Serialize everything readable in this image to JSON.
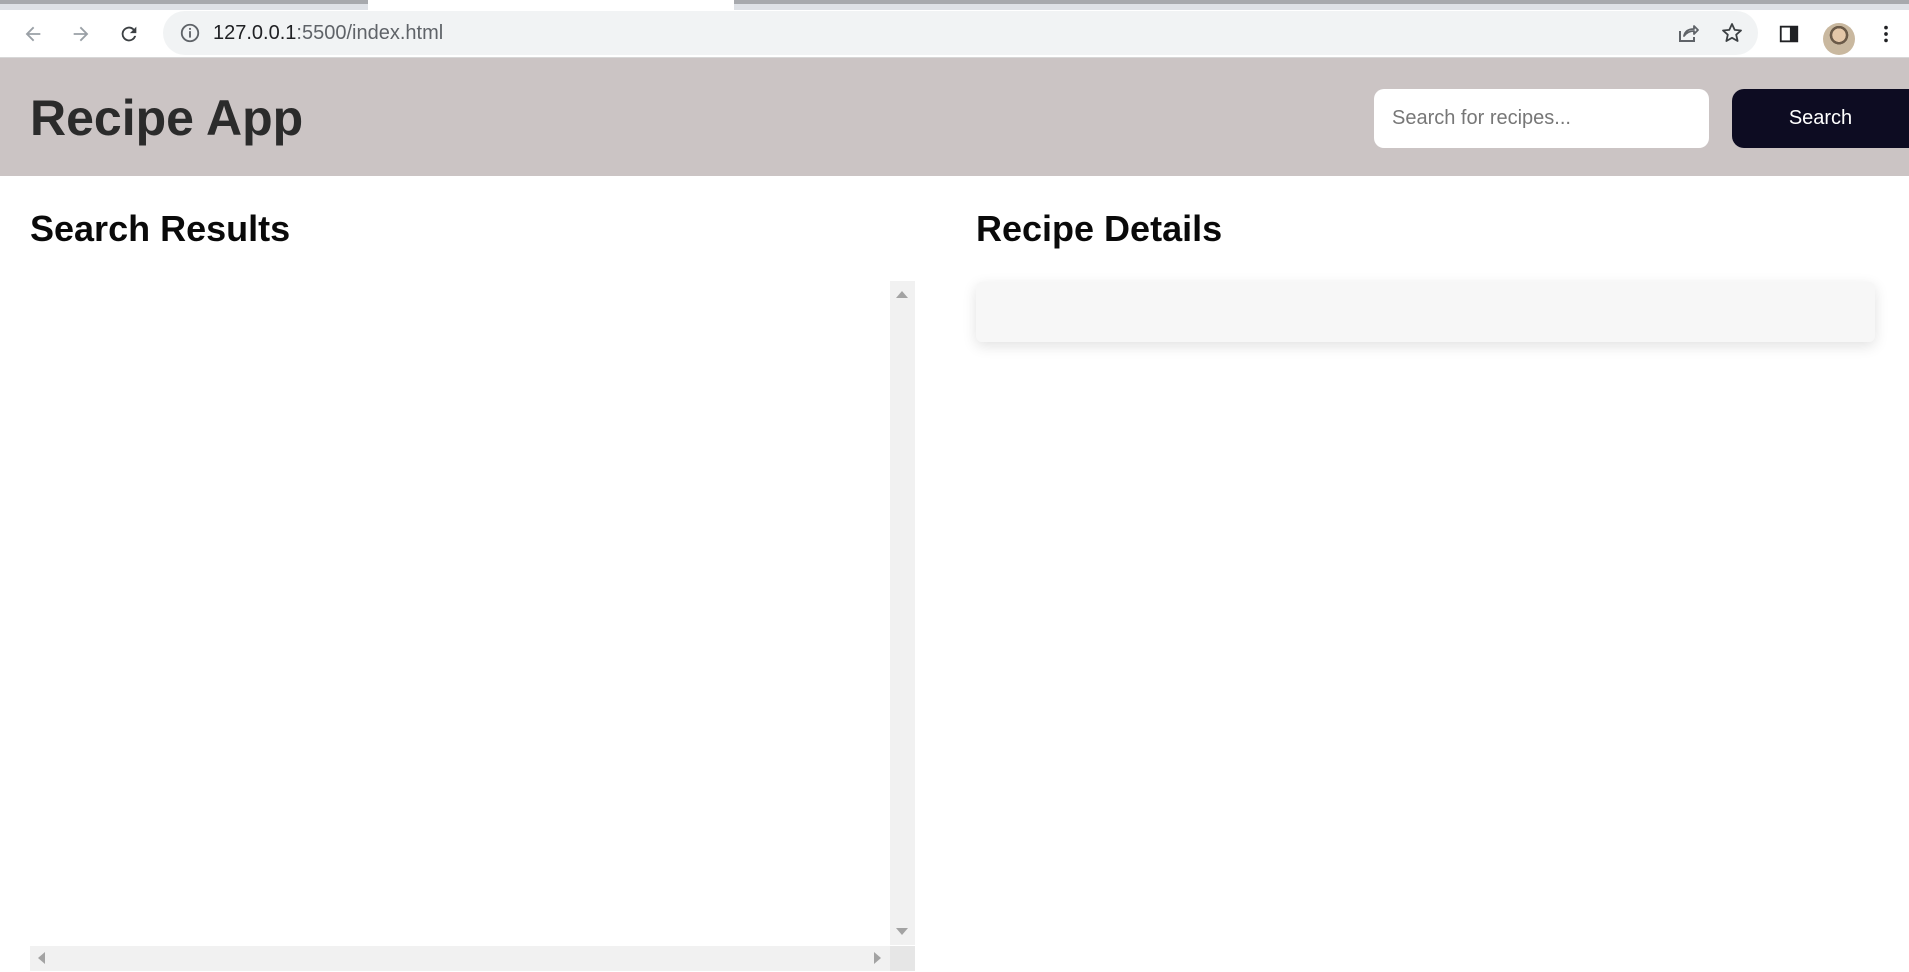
{
  "browser": {
    "url_host": "127.0.0.1",
    "url_rest": ":5500/index.html",
    "icons": {
      "back": "arrow-left-icon",
      "forward": "arrow-right-icon",
      "reload": "reload-icon",
      "info": "info-icon",
      "share": "share-icon",
      "bookmark": "star-icon",
      "side_panel": "side-panel-icon",
      "menu": "kebab-menu-icon"
    }
  },
  "header": {
    "title": "Recipe App",
    "search_placeholder": "Search for recipes...",
    "search_value": "",
    "search_button": "Search",
    "bg_color": "#cbc4c4",
    "button_color": "#0d0c22"
  },
  "results": {
    "title": "Search Results",
    "items": []
  },
  "details": {
    "title": "Recipe Details",
    "content": ""
  }
}
